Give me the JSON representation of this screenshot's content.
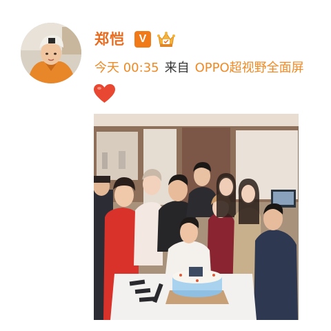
{
  "post": {
    "author": {
      "name": "郑恺",
      "verified_badge": "V",
      "verified_icon": "verified-v-icon",
      "member_icon": "crown-member-icon"
    },
    "meta": {
      "time": "今天 00:35",
      "from_label": "来自",
      "device": "OPPO超视野全面屏"
    },
    "content": {
      "emoji": "heart-icon"
    },
    "image": {
      "description_icon": "group-photo"
    }
  },
  "colors": {
    "username": "#e86c20",
    "link": "#f08a24",
    "heart": "#e84832",
    "badge": "#f07a18"
  }
}
